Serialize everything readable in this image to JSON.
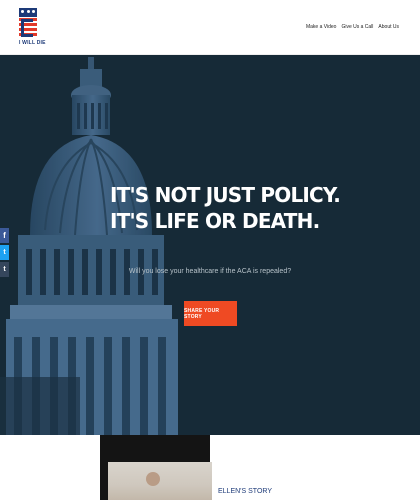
{
  "header": {
    "logo_text": "I WILL DIE",
    "nav": [
      {
        "label": "Make a Video"
      },
      {
        "label": "Give Us a Call"
      },
      {
        "label": "About Us"
      }
    ]
  },
  "hero": {
    "headline_line1": "IT'S NOT JUST POLICY.",
    "headline_line2": "IT'S LIFE OR DEATH.",
    "subline": "Will you lose your healthcare if the ACA is repealed?",
    "cta_label": "SHARE YOUR STORY"
  },
  "social": {
    "facebook": "f",
    "twitter": "t",
    "tumblr": "t"
  },
  "story": {
    "title": "ELLEN'S STORY"
  },
  "colors": {
    "hero_bg": "#162a37",
    "accent": "#ef4a23",
    "brand_blue": "#1d3a78"
  }
}
